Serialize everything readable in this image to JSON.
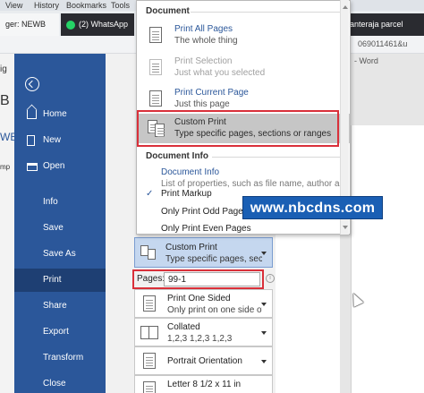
{
  "browser": {
    "menu": [
      "View",
      "History",
      "Bookmarks",
      "Tools"
    ],
    "tabs": [
      {
        "label": "ger: NEWB"
      },
      {
        "label": "(2) WhatsApp"
      },
      {
        "label": "anteraja parcel"
      }
    ],
    "url_fragment": "069011461&u"
  },
  "word": {
    "title_fragment": "- Word",
    "left_fragments": [
      "ig",
      "B",
      "WE",
      "mp"
    ]
  },
  "backstage": {
    "items": [
      {
        "label": "Home",
        "icon": "home-icon"
      },
      {
        "label": "New",
        "icon": "new-doc-icon"
      },
      {
        "label": "Open",
        "icon": "folder-open-icon"
      },
      {
        "label": "Info"
      },
      {
        "label": "Save"
      },
      {
        "label": "Save As"
      },
      {
        "label": "Print",
        "active": true
      },
      {
        "label": "Share"
      },
      {
        "label": "Export"
      },
      {
        "label": "Transform"
      },
      {
        "label": "Close"
      }
    ]
  },
  "popup": {
    "section_document": "Document",
    "options": [
      {
        "title": "Print All Pages",
        "sub": "The whole thing"
      },
      {
        "title": "Print Selection",
        "sub": "Just what you selected",
        "disabled": true
      },
      {
        "title": "Print Current Page",
        "sub": "Just this page"
      },
      {
        "title": "Custom Print",
        "sub": "Type specific pages, sections or ranges",
        "highlighted": true
      }
    ],
    "section_doc_info": "Document Info",
    "doc_info": {
      "title": "Document Info",
      "sub": "List of properties, such as file name, author and title"
    },
    "print_markup": "Print Markup",
    "odd_pages": "Only Print Odd Pages",
    "even_pages": "Only Print Even Pages"
  },
  "print_settings": {
    "current": {
      "title": "Custom Print",
      "sub": "Type specific pages, sections or ranges"
    },
    "pages_label": "Pages:",
    "pages_value": "99-1",
    "one_sided": {
      "title": "Print One Sided",
      "sub": "Only print on one side of the page"
    },
    "collated": {
      "title": "Collated",
      "sub": "1,2,3    1,2,3    1,2,3"
    },
    "orientation": {
      "title": "Portrait Orientation"
    },
    "paper": {
      "title": "Letter 8 1/2 x 11 in"
    }
  },
  "watermark": "www.nbcdns.com",
  "colors": {
    "word_blue": "#2b579a",
    "highlight_red": "#d9303a",
    "watermark_blue": "#1a5fb4"
  }
}
